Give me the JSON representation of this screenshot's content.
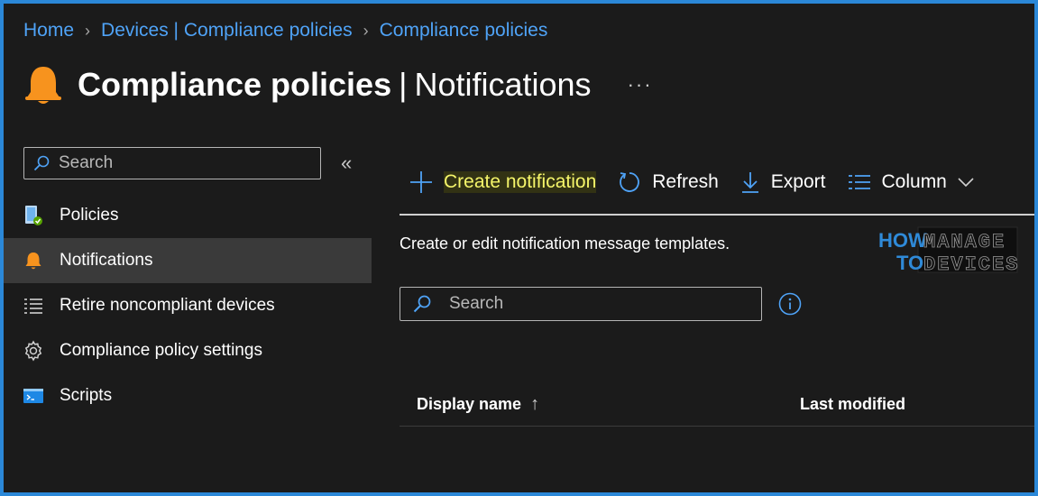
{
  "breadcrumb": [
    "Home",
    "Devices | Compliance policies",
    "Compliance policies"
  ],
  "header": {
    "title": "Compliance policies",
    "separator": "|",
    "subtitle": "Notifications",
    "more": "···",
    "icon": "bell-icon"
  },
  "sidebar": {
    "search_placeholder": "Search",
    "collapse": "«",
    "items": [
      {
        "label": "Policies",
        "icon": "policies-icon",
        "active": false
      },
      {
        "label": "Notifications",
        "icon": "bell-icon",
        "active": true
      },
      {
        "label": "Retire noncompliant devices",
        "icon": "list-icon",
        "active": false
      },
      {
        "label": "Compliance policy settings",
        "icon": "gear-icon",
        "active": false
      },
      {
        "label": "Scripts",
        "icon": "script-icon",
        "active": false
      }
    ]
  },
  "toolbar": {
    "create": "Create notification",
    "refresh": "Refresh",
    "export": "Export",
    "columns": "Column"
  },
  "main": {
    "description": "Create or edit notification message templates.",
    "search_placeholder": "Search",
    "columns": [
      {
        "label": "Display name",
        "sort": "↑"
      },
      {
        "label": "Last modified"
      }
    ]
  },
  "watermark": {
    "line1a": "HOW",
    "line1b": "MANAGE",
    "line2a": "TO",
    "line2b": "DEVICES"
  },
  "colors": {
    "accent": "#4fa3f7",
    "bell": "#f7931e",
    "highlight": "#f5f56a",
    "active_bg": "#3a3a3a"
  }
}
